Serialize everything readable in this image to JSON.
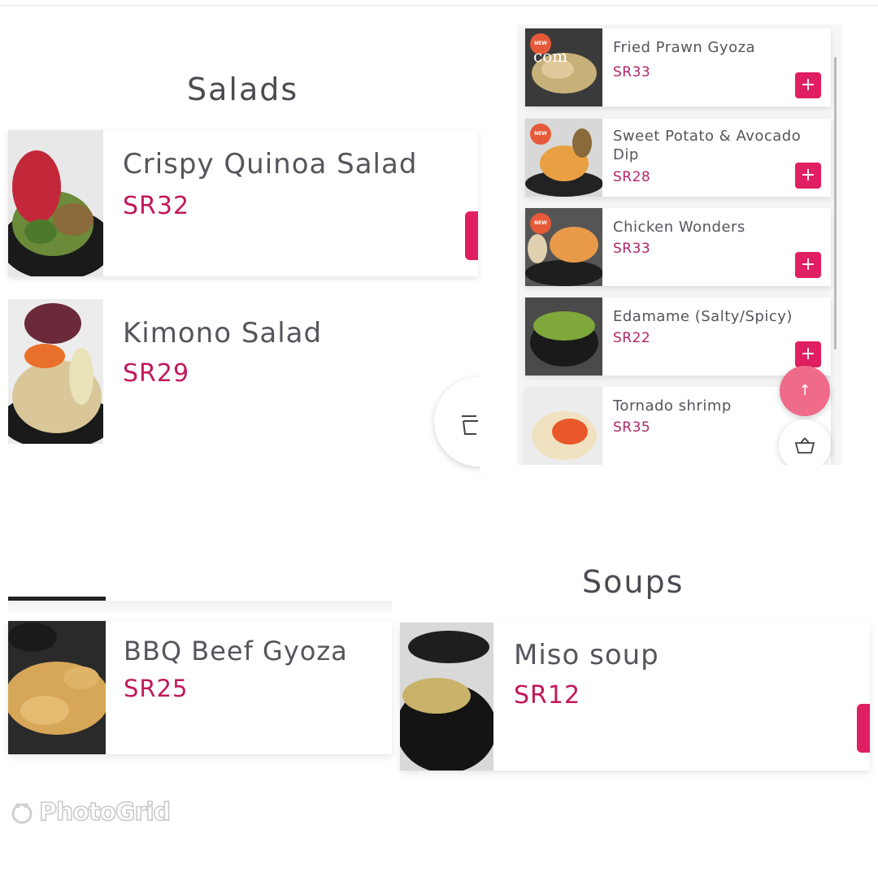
{
  "panels": {
    "salads": {
      "title": "Salads",
      "items": [
        {
          "name": "Crispy Quinoa Salad",
          "price": "SR32"
        },
        {
          "name": "Kimono Salad",
          "price": "SR29"
        }
      ]
    },
    "menu_list": {
      "items": [
        {
          "name": "Fried Prawn Gyoza",
          "price": "SR33",
          "badge": "NEW",
          "overlay": "com"
        },
        {
          "name": "Sweet Potato & Avocado Dip",
          "price": "SR28",
          "badge": "NEW"
        },
        {
          "name": "Chicken Wonders",
          "price": "SR33",
          "badge": "NEW"
        },
        {
          "name": "Edamame (Salty/Spicy)",
          "price": "SR22"
        },
        {
          "name": "Tornado shrimp",
          "price": "SR35"
        }
      ],
      "add_label": "+",
      "scroll_up_label": "↑"
    },
    "gyoza": {
      "items": [
        {
          "name": "BBQ Beef Gyoza",
          "price": "SR25"
        }
      ]
    },
    "soups": {
      "title": "Soups",
      "items": [
        {
          "name": "Miso soup",
          "price": "SR12"
        }
      ]
    }
  },
  "watermark": "PhotoGrid",
  "colors": {
    "accent": "#e01f62",
    "price": "#c2185b",
    "badge": "#e65a3a"
  },
  "icons": [
    "basket-icon",
    "arrow-up-icon",
    "plus-icon"
  ]
}
